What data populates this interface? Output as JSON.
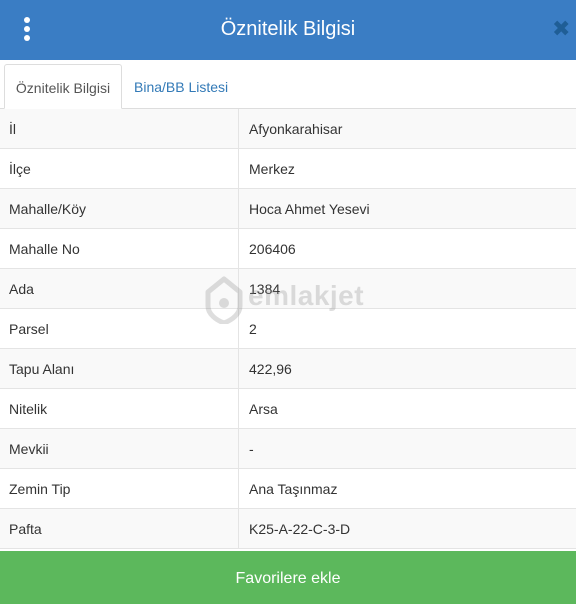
{
  "header": {
    "title": "Öznitelik Bilgisi",
    "menu_icon": "kebab-menu-icon",
    "close_icon": "close-icon",
    "close_glyph": "✖"
  },
  "tabs": [
    {
      "label": "Öznitelik Bilgisi",
      "active": true
    },
    {
      "label": "Bina/BB Listesi",
      "active": false
    }
  ],
  "rows": [
    {
      "label": "İl",
      "value": "Afyonkarahisar"
    },
    {
      "label": "İlçe",
      "value": "Merkez"
    },
    {
      "label": "Mahalle/Köy",
      "value": "Hoca Ahmet Yesevi"
    },
    {
      "label": "Mahalle No",
      "value": "206406"
    },
    {
      "label": "Ada",
      "value": "1384"
    },
    {
      "label": "Parsel",
      "value": "2"
    },
    {
      "label": "Tapu Alanı",
      "value": "422,96"
    },
    {
      "label": "Nitelik",
      "value": "Arsa"
    },
    {
      "label": "Mevkii",
      "value": "-"
    },
    {
      "label": "Zemin Tip",
      "value": "Ana Taşınmaz"
    },
    {
      "label": "Pafta",
      "value": "K25-A-22-C-3-D"
    }
  ],
  "watermark": {
    "text": "emlakjet"
  },
  "footer": {
    "button_label": "Favorilere ekle"
  },
  "colors": {
    "header": "#3a7dc4",
    "footer": "#5cb85c",
    "link": "#337ab7"
  }
}
